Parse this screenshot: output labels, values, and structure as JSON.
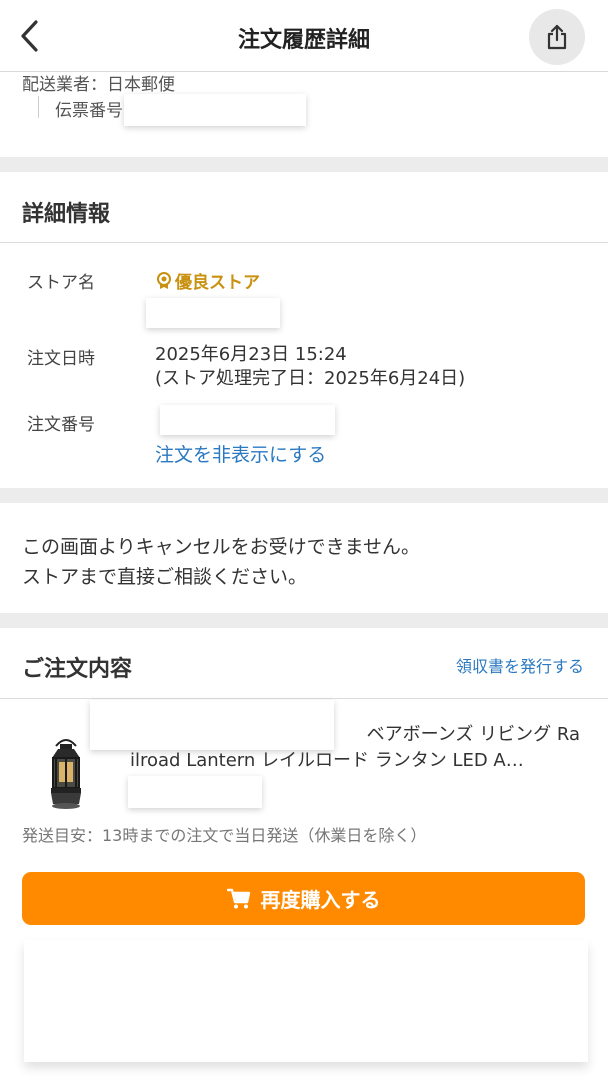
{
  "header": {
    "title": "注文履歴詳細",
    "back_icon": "chevron-left-icon",
    "share_icon": "share-icon"
  },
  "shipping": {
    "carrier": "配送業者：日本郵便",
    "slip_label": "伝票番号"
  },
  "details": {
    "title": "詳細情報",
    "store_label": "ストア名",
    "store_badge": "優良ストア",
    "date_label": "注文日時",
    "date_value": "2025年6月23日 15:24",
    "processed_value": "(ストア処理完了日：2025年6月24日)",
    "order_no_label": "注文番号",
    "hide_link": "注文を非表示にする"
  },
  "notice": {
    "line1": "この画面よりキャンセルをお受けできません。",
    "line2": "ストアまで直接ご相談ください。"
  },
  "order": {
    "title": "ご注文内容",
    "receipt_link": "領収書を発行する",
    "product_line1": "ベアボーンズ リビング Ra",
    "product_line2": "ilroad Lantern レイルロード ランタン LED A…",
    "ship_estimate": "発送目安：13時までの注文で当日発送（休業日を除く）",
    "rebuy_label": "再度購入する"
  },
  "colors": {
    "accent": "#ff8a00",
    "link": "#2b79c2",
    "badge": "#c8910f"
  }
}
